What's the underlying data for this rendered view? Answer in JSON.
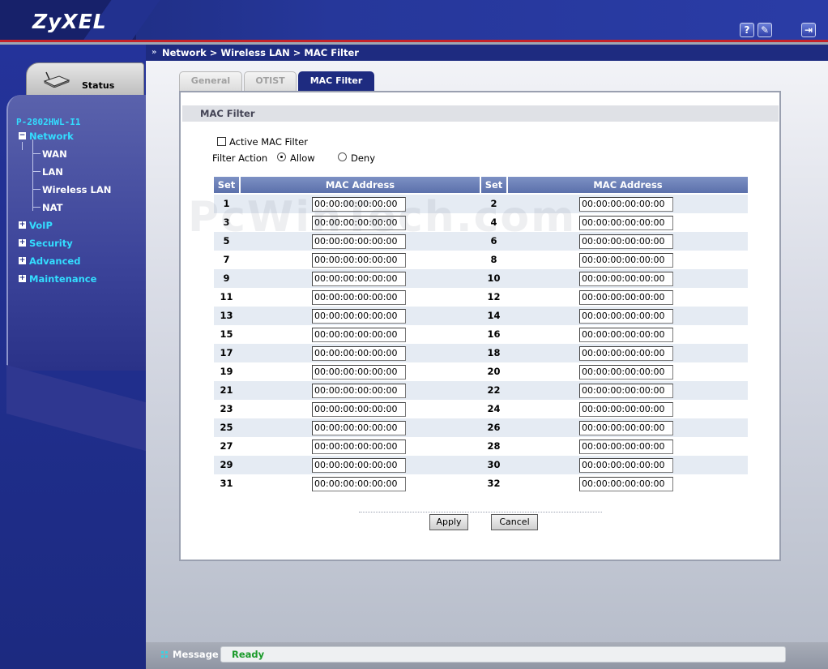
{
  "brand": {
    "logo": "ZyXEL"
  },
  "top_icons": [
    {
      "name": "help-icon",
      "glyph": "?"
    },
    {
      "name": "wizard-icon",
      "glyph": "✎"
    },
    {
      "name": "logout-icon",
      "glyph": "⇥"
    }
  ],
  "sidebar": {
    "status_label": "Status",
    "device_name": "P-2802HWL-I1",
    "network": {
      "label": "Network",
      "expanded": true,
      "children": [
        "WAN",
        "LAN",
        "Wireless LAN",
        "NAT"
      ]
    },
    "items": [
      "VoIP",
      "Security",
      "Advanced",
      "Maintenance"
    ]
  },
  "breadcrumb": "Network > Wireless LAN > MAC Filter",
  "tabs": [
    {
      "label": "General",
      "active": false
    },
    {
      "label": "OTIST",
      "active": false
    },
    {
      "label": "MAC Filter",
      "active": true
    }
  ],
  "panel": {
    "title": "MAC Filter",
    "active_mac_filter": {
      "label": "Active MAC Filter",
      "checked": false
    },
    "filter_action": {
      "label": "Filter Action",
      "allow_label": "Allow",
      "deny_label": "Deny",
      "selected": "Allow"
    }
  },
  "table": {
    "headers": {
      "set": "Set",
      "mac": "MAC Address"
    },
    "rows": [
      {
        "left": {
          "set": "1",
          "mac": "00:00:00:00:00:00"
        },
        "right": {
          "set": "2",
          "mac": "00:00:00:00:00:00"
        }
      },
      {
        "left": {
          "set": "3",
          "mac": "00:00:00:00:00:00"
        },
        "right": {
          "set": "4",
          "mac": "00:00:00:00:00:00"
        }
      },
      {
        "left": {
          "set": "5",
          "mac": "00:00:00:00:00:00"
        },
        "right": {
          "set": "6",
          "mac": "00:00:00:00:00:00"
        }
      },
      {
        "left": {
          "set": "7",
          "mac": "00:00:00:00:00:00"
        },
        "right": {
          "set": "8",
          "mac": "00:00:00:00:00:00"
        }
      },
      {
        "left": {
          "set": "9",
          "mac": "00:00:00:00:00:00"
        },
        "right": {
          "set": "10",
          "mac": "00:00:00:00:00:00"
        }
      },
      {
        "left": {
          "set": "11",
          "mac": "00:00:00:00:00:00"
        },
        "right": {
          "set": "12",
          "mac": "00:00:00:00:00:00"
        }
      },
      {
        "left": {
          "set": "13",
          "mac": "00:00:00:00:00:00"
        },
        "right": {
          "set": "14",
          "mac": "00:00:00:00:00:00"
        }
      },
      {
        "left": {
          "set": "15",
          "mac": "00:00:00:00:00:00"
        },
        "right": {
          "set": "16",
          "mac": "00:00:00:00:00:00"
        }
      },
      {
        "left": {
          "set": "17",
          "mac": "00:00:00:00:00:00"
        },
        "right": {
          "set": "18",
          "mac": "00:00:00:00:00:00"
        }
      },
      {
        "left": {
          "set": "19",
          "mac": "00:00:00:00:00:00"
        },
        "right": {
          "set": "20",
          "mac": "00:00:00:00:00:00"
        }
      },
      {
        "left": {
          "set": "21",
          "mac": "00:00:00:00:00:00"
        },
        "right": {
          "set": "22",
          "mac": "00:00:00:00:00:00"
        }
      },
      {
        "left": {
          "set": "23",
          "mac": "00:00:00:00:00:00"
        },
        "right": {
          "set": "24",
          "mac": "00:00:00:00:00:00"
        }
      },
      {
        "left": {
          "set": "25",
          "mac": "00:00:00:00:00:00"
        },
        "right": {
          "set": "26",
          "mac": "00:00:00:00:00:00"
        }
      },
      {
        "left": {
          "set": "27",
          "mac": "00:00:00:00:00:00"
        },
        "right": {
          "set": "28",
          "mac": "00:00:00:00:00:00"
        }
      },
      {
        "left": {
          "set": "29",
          "mac": "00:00:00:00:00:00"
        },
        "right": {
          "set": "30",
          "mac": "00:00:00:00:00:00"
        }
      },
      {
        "left": {
          "set": "31",
          "mac": "00:00:00:00:00:00"
        },
        "right": {
          "set": "32",
          "mac": "00:00:00:00:00:00"
        }
      }
    ]
  },
  "buttons": {
    "apply": "Apply",
    "cancel": "Cancel"
  },
  "footer": {
    "message_label": "Message",
    "message_value": "Ready"
  },
  "watermark": "PcWinTech.com",
  "colors": {
    "nav_blue": "#1e2b80",
    "accent_cyan": "#33ddff",
    "accent_red": "#c4222a",
    "ready_green": "#1a9a2a"
  }
}
